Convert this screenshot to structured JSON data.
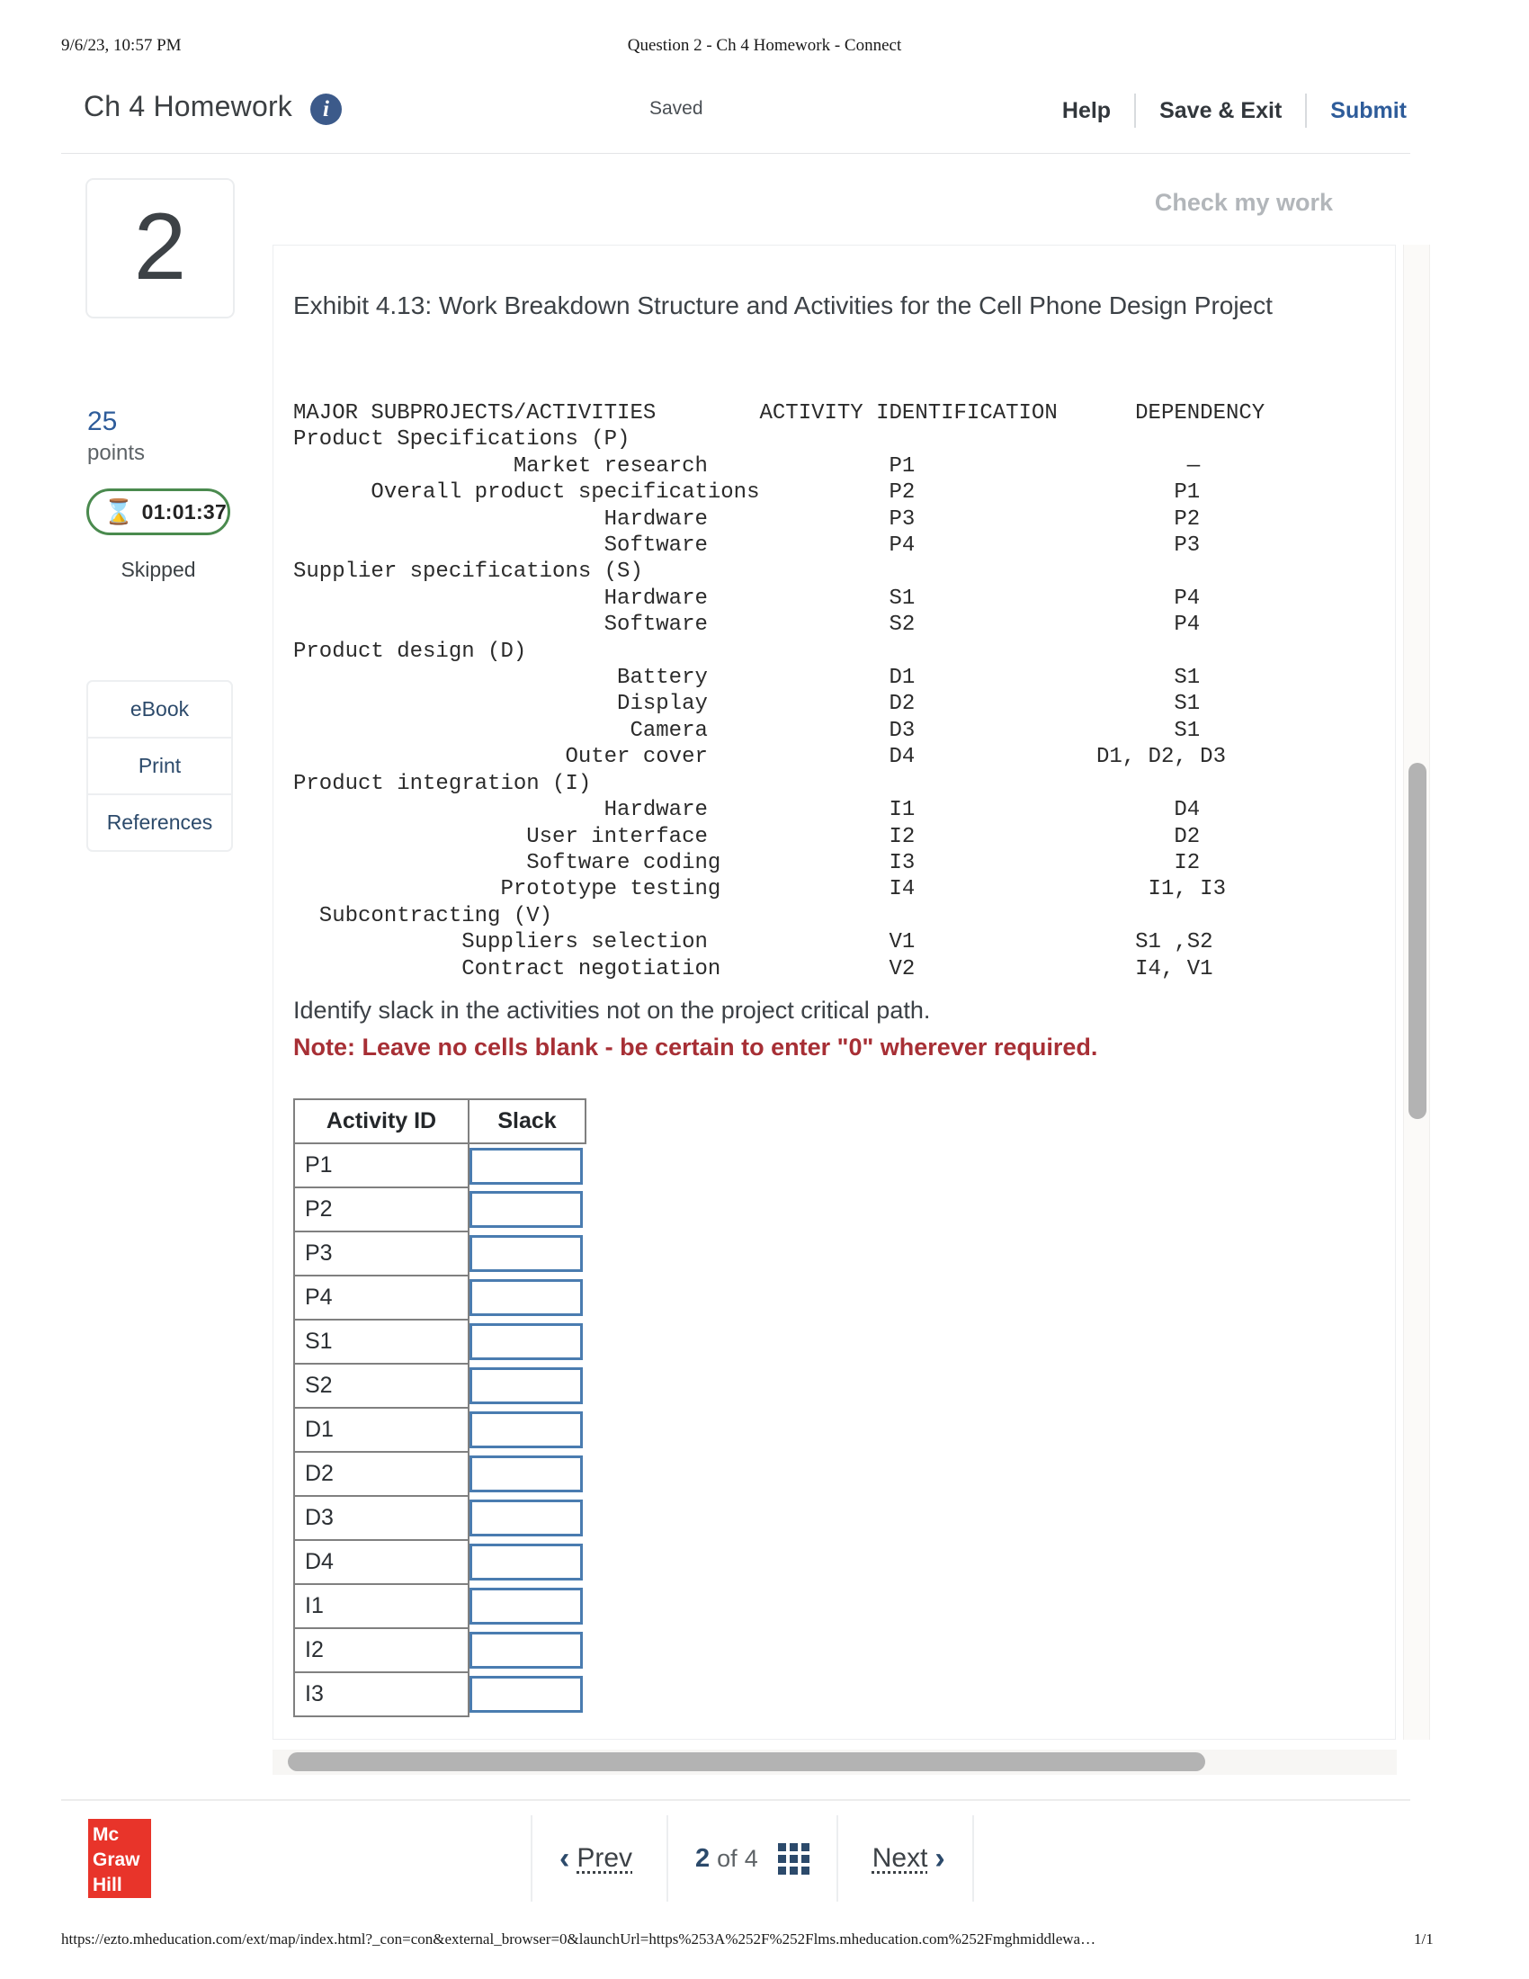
{
  "print": {
    "date": "9/6/23, 10:57 PM",
    "doc_title": "Question 2 - Ch 4 Homework - Connect",
    "footer_url": "https://ezto.mheducation.com/ext/map/index.html?_con=con&external_browser=0&launchUrl=https%253A%252F%252Flms.mheducation.com%252Fmghmiddlewa…",
    "footer_page": "1/1"
  },
  "header": {
    "title": "Ch 4 Homework",
    "info_icon_glyph": "i",
    "saved_label": "Saved",
    "help_label": "Help",
    "save_exit_label": "Save & Exit",
    "submit_label": "Submit"
  },
  "rail": {
    "question_number": "2",
    "points_value": "25",
    "points_word": "points",
    "timer_value": "01:01:37",
    "hourglass_glyph": "⌛",
    "status": "Skipped",
    "buttons": [
      "eBook",
      "Print",
      "References"
    ]
  },
  "panel": {
    "check_my_work": "Check my work",
    "exhibit_title": "Exhibit 4.13: Work Breakdown Structure and Activities for the Cell Phone Design Project",
    "question_prompt": "Identify slack in the activities not on the project critical path.",
    "question_note": "Note: Leave no cells blank - be certain to enter \"0\" wherever required."
  },
  "wbs": {
    "columns": [
      "MAJOR SUBPROJECTS/ACTIVITIES",
      "ACTIVITY IDENTIFICATION",
      "DEPENDENCY"
    ],
    "text": "MAJOR SUBPROJECTS/ACTIVITIES        ACTIVITY IDENTIFICATION      DEPENDENCY\nProduct Specifications (P)\n                 Market research              P1                     —\n      Overall product specifications          P2                    P1\n                        Hardware              P3                    P2\n                        Software              P4                    P3\nSupplier specifications (S)\n                        Hardware              S1                    P4\n                        Software              S2                    P4\nProduct design (D)\n                         Battery              D1                    S1\n                         Display              D2                    S1\n                          Camera              D3                    S1\n                     Outer cover              D4              D1, D2, D3\nProduct integration (I)\n                        Hardware              I1                    D4\n                  User interface              I2                    D2\n                  Software coding             I3                    I2\n                Prototype testing             I4                  I1, I3\n  Subcontracting (V)\n             Suppliers selection              V1                 S1 ,S2\n             Contract negotiation             V2                 I4, V1",
    "rows": [
      {
        "activity": "Product Specifications (P)",
        "id": "",
        "dependency": "",
        "group": true
      },
      {
        "activity": "Market research",
        "id": "P1",
        "dependency": "—"
      },
      {
        "activity": "Overall product specifications",
        "id": "P2",
        "dependency": "P1"
      },
      {
        "activity": "Hardware",
        "id": "P3",
        "dependency": "P2"
      },
      {
        "activity": "Software",
        "id": "P4",
        "dependency": "P3"
      },
      {
        "activity": "Supplier specifications (S)",
        "id": "",
        "dependency": "",
        "group": true
      },
      {
        "activity": "Hardware",
        "id": "S1",
        "dependency": "P4"
      },
      {
        "activity": "Software",
        "id": "S2",
        "dependency": "P4"
      },
      {
        "activity": "Product design (D)",
        "id": "",
        "dependency": "",
        "group": true
      },
      {
        "activity": "Battery",
        "id": "D1",
        "dependency": "S1"
      },
      {
        "activity": "Display",
        "id": "D2",
        "dependency": "S1"
      },
      {
        "activity": "Camera",
        "id": "D3",
        "dependency": "S1"
      },
      {
        "activity": "Outer cover",
        "id": "D4",
        "dependency": "D1, D2, D3"
      },
      {
        "activity": "Product integration (I)",
        "id": "",
        "dependency": "",
        "group": true
      },
      {
        "activity": "Hardware",
        "id": "I1",
        "dependency": "D4"
      },
      {
        "activity": "User interface",
        "id": "I2",
        "dependency": "D2"
      },
      {
        "activity": "Software coding",
        "id": "I3",
        "dependency": "I2"
      },
      {
        "activity": "Prototype testing",
        "id": "I4",
        "dependency": "I1, I3"
      },
      {
        "activity": "Subcontracting (V)",
        "id": "",
        "dependency": "",
        "group": true
      },
      {
        "activity": "Suppliers selection",
        "id": "V1",
        "dependency": "S1 ,S2"
      },
      {
        "activity": "Contract negotiation",
        "id": "V2",
        "dependency": "I4, V1"
      }
    ]
  },
  "answer_table": {
    "headers": [
      "Activity ID",
      "Slack"
    ],
    "rows": [
      {
        "activity_id": "P1",
        "slack": ""
      },
      {
        "activity_id": "P2",
        "slack": ""
      },
      {
        "activity_id": "P3",
        "slack": ""
      },
      {
        "activity_id": "P4",
        "slack": ""
      },
      {
        "activity_id": "S1",
        "slack": ""
      },
      {
        "activity_id": "S2",
        "slack": ""
      },
      {
        "activity_id": "D1",
        "slack": ""
      },
      {
        "activity_id": "D2",
        "slack": ""
      },
      {
        "activity_id": "D3",
        "slack": ""
      },
      {
        "activity_id": "D4",
        "slack": ""
      },
      {
        "activity_id": "I1",
        "slack": ""
      },
      {
        "activity_id": "I2",
        "slack": ""
      },
      {
        "activity_id": "I3",
        "slack": ""
      }
    ]
  },
  "bottom_nav": {
    "brand_line1": "Mc",
    "brand_line2": "Graw",
    "brand_line3": "Hill",
    "prev_label": "Prev",
    "next_label": "Next",
    "page_current": "2",
    "page_of": "of",
    "page_total": "4",
    "chevron_left": "‹",
    "chevron_right": "›"
  },
  "colors": {
    "accent_blue": "#2e5c9a",
    "note_red": "#a72f35",
    "timer_green": "#4a8a4e",
    "brand_red": "#e8342a",
    "input_border": "#4a7cb0"
  }
}
